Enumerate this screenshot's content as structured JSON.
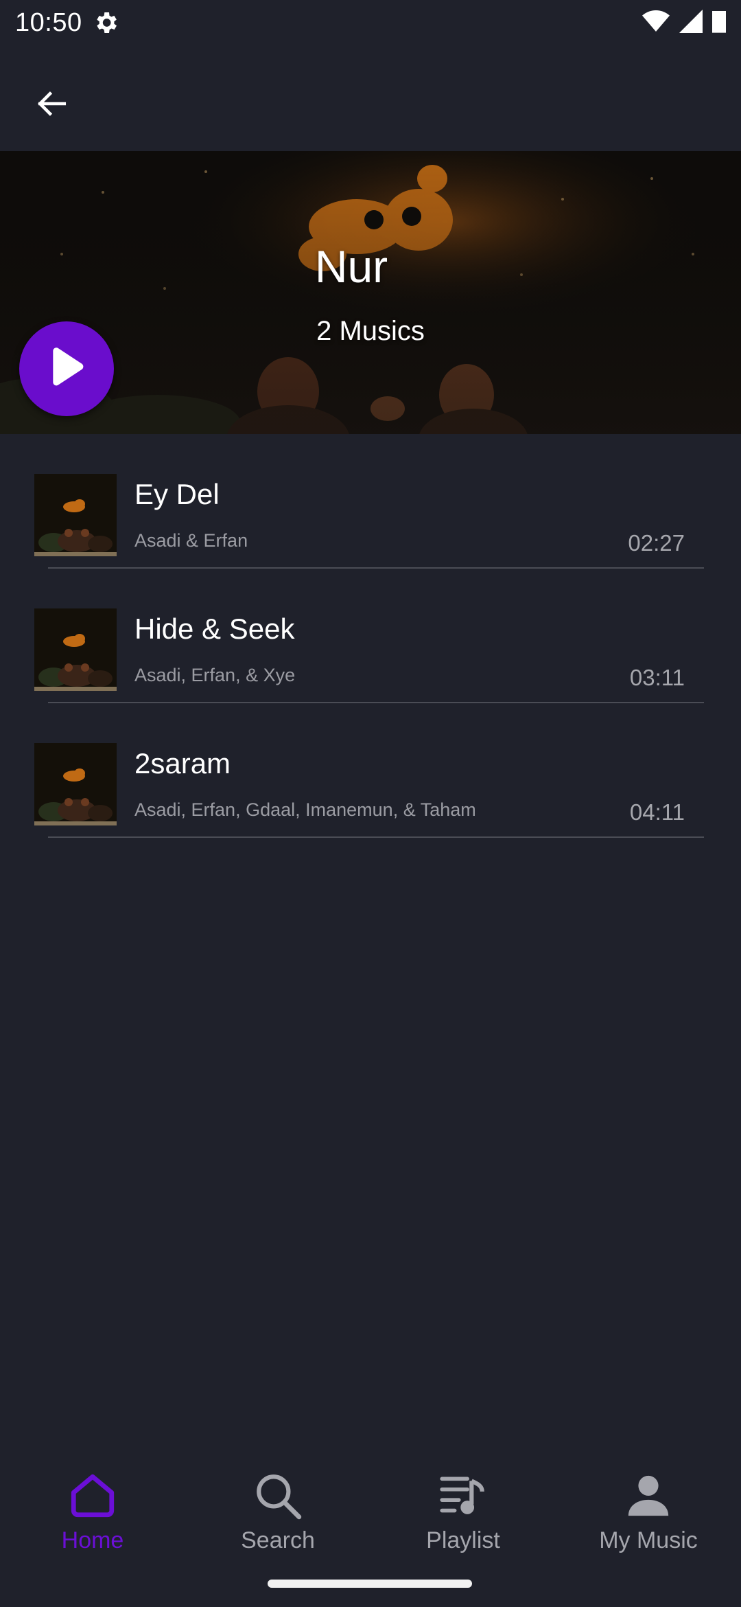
{
  "status_bar": {
    "time": "10:50"
  },
  "header": {
    "back_icon": "arrow-left-icon"
  },
  "album": {
    "title": "Nur",
    "count_label": "2 Musics",
    "accent_color": "#6a0dcc"
  },
  "tracks": [
    {
      "title": "Ey Del",
      "artist": "Asadi & Erfan",
      "duration": "02:27"
    },
    {
      "title": "Hide & Seek",
      "artist": "Asadi, Erfan, & Xye",
      "duration": "03:11"
    },
    {
      "title": "2saram",
      "artist": "Asadi, Erfan, Gdaal, Imanemun, & Taham",
      "duration": "04:11"
    }
  ],
  "bottom_nav": {
    "items": [
      {
        "label": "Home",
        "icon": "home-icon",
        "active": true
      },
      {
        "label": "Search",
        "icon": "search-icon",
        "active": false
      },
      {
        "label": "Playlist",
        "icon": "playlist-icon",
        "active": false
      },
      {
        "label": "My Music",
        "icon": "person-icon",
        "active": false
      }
    ],
    "active_color": "#6b0fd6",
    "inactive_color": "#a5a6ad"
  }
}
